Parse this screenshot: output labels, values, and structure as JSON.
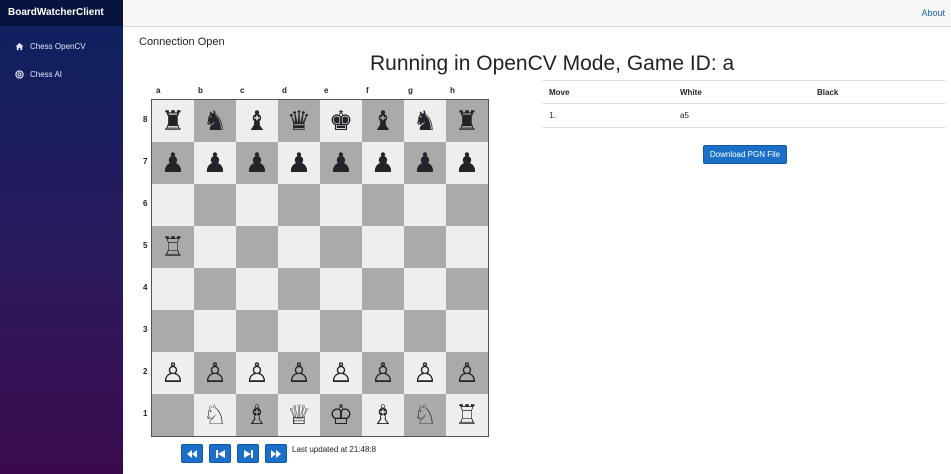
{
  "app": {
    "brand": "BoardWatcherClient"
  },
  "sidebar": {
    "items": [
      {
        "label": "Chess OpenCV",
        "icon": "home-icon"
      },
      {
        "label": "Chess AI",
        "icon": "target-icon"
      }
    ]
  },
  "topbar": {
    "about_label": "About"
  },
  "status": "Connection Open",
  "heading": "Running in OpenCV Mode, Game ID: a",
  "board": {
    "files": [
      "a",
      "b",
      "c",
      "d",
      "e",
      "f",
      "g",
      "h"
    ],
    "ranks": [
      "8",
      "7",
      "6",
      "5",
      "4",
      "3",
      "2",
      "1"
    ],
    "position": [
      [
        "♜",
        "♞",
        "♝",
        "♛",
        "♚",
        "♝",
        "♞",
        "♜"
      ],
      [
        "♟",
        "♟",
        "♟",
        "♟",
        "♟",
        "♟",
        "♟",
        "♟"
      ],
      [
        "",
        "",
        "",
        "",
        "",
        "",
        "",
        ""
      ],
      [
        "♖",
        "",
        "",
        "",
        "",
        "",
        "",
        ""
      ],
      [
        "",
        "",
        "",
        "",
        "",
        "",
        "",
        ""
      ],
      [
        "",
        "",
        "",
        "",
        "",
        "",
        "",
        ""
      ],
      [
        "♙",
        "♙",
        "♙",
        "♙",
        "♙",
        "♙",
        "♙",
        "♙"
      ],
      [
        "",
        "♘",
        "♗",
        "♕",
        "♔",
        "♗",
        "♘",
        "♖"
      ]
    ],
    "light_color": "#eeeeee",
    "dark_color": "#aaaaaa"
  },
  "controls": {
    "first_label": "⏪",
    "prev_label": "⏮",
    "next_label": "⏭",
    "last_label": "⏩",
    "updated_text": "Last updated at 21:48:8"
  },
  "moves": {
    "headers": [
      "Move",
      "White",
      "Black"
    ],
    "rows": [
      {
        "num": "1.",
        "white": "a5",
        "black": ""
      }
    ],
    "download_label": "Download PGN File"
  }
}
